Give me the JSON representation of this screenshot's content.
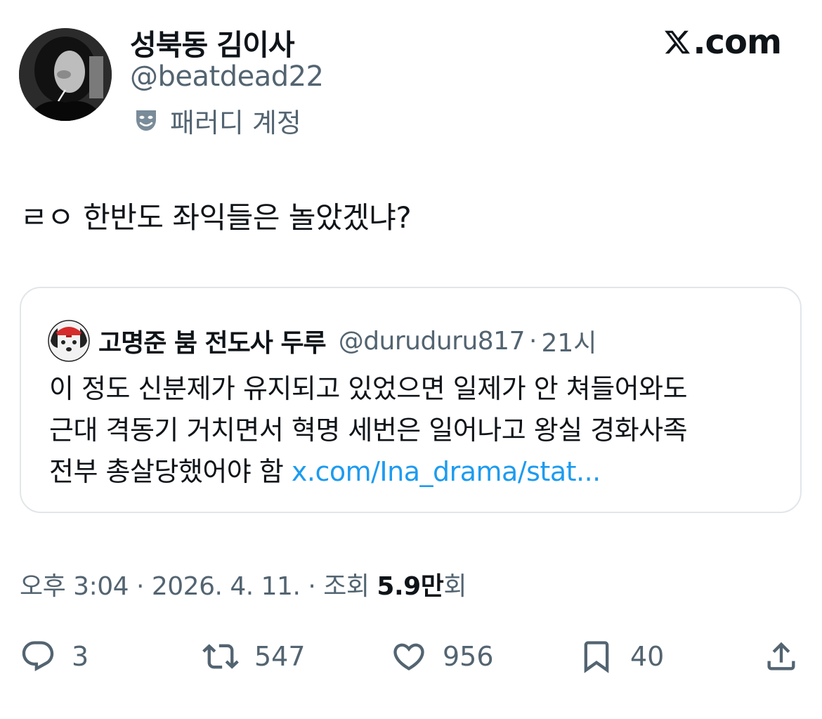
{
  "author": {
    "display_name": "성북동 김이사",
    "handle": "@beatdead22",
    "parody_label": "패러디 계정",
    "avatar_icon": "avatar-photo",
    "parody_icon": "theater-mask-icon"
  },
  "brand": {
    "logo_icon": "x-logo-icon",
    "logo_text": ".com"
  },
  "tweet": {
    "text": "ㄹㅇ 한반도 좌익들은 놀았겠냐?"
  },
  "quote": {
    "avatar_icon": "dog-avatar",
    "display_name": "고명준 붐 전도사 두루",
    "handle": "@duruduru817",
    "separator": "·",
    "time": "21시",
    "lines": [
      "이 정도 신분제가 유지되고 있었으면 일제가 안 쳐들어와도",
      "근대 격동기 거치면서 혁명 세번은 일어나고 왕실 경화사족",
      "전부 총살당했어야 함 "
    ],
    "link": "x.com/Ina_drama/stat..."
  },
  "meta": {
    "prefix": "오후 3:04 · 2026. 4. 11. · 조회 ",
    "views": "5.9만",
    "suffix": "회"
  },
  "actions": {
    "replies": "3",
    "reposts": "547",
    "likes": "956",
    "bookmarks": "40"
  },
  "colors": {
    "text": "#0f1419",
    "secondary": "#536471",
    "link": "#1d9bf0",
    "border": "#e2e6e9"
  }
}
